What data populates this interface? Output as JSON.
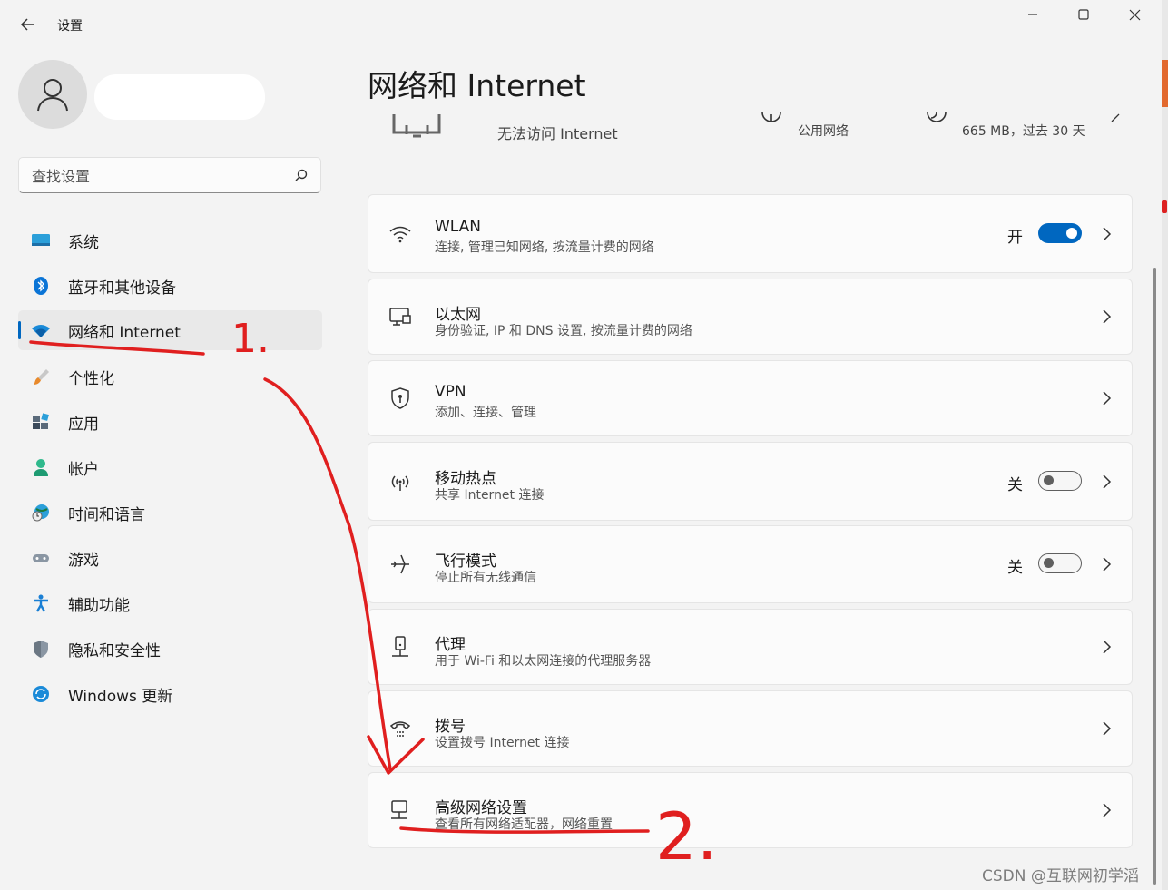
{
  "window": {
    "title": "设置",
    "controls": {
      "minimize": "minimize",
      "maximize": "maximize",
      "close": "close"
    }
  },
  "search": {
    "placeholder": "查找设置"
  },
  "sidebar": {
    "items": [
      {
        "label": "系统",
        "icon": "monitor-icon",
        "active": false
      },
      {
        "label": "蓝牙和其他设备",
        "icon": "bluetooth-icon",
        "active": false
      },
      {
        "label": "网络和 Internet",
        "icon": "wifi-diamond-icon",
        "active": true
      },
      {
        "label": "个性化",
        "icon": "brush-icon",
        "active": false
      },
      {
        "label": "应用",
        "icon": "apps-icon",
        "active": false
      },
      {
        "label": "帐户",
        "icon": "account-icon",
        "active": false
      },
      {
        "label": "时间和语言",
        "icon": "globe-clock-icon",
        "active": false
      },
      {
        "label": "游戏",
        "icon": "gamepad-icon",
        "active": false
      },
      {
        "label": "辅助功能",
        "icon": "accessibility-icon",
        "active": false
      },
      {
        "label": "隐私和安全性",
        "icon": "shield-icon",
        "active": false
      },
      {
        "label": "Windows 更新",
        "icon": "update-icon",
        "active": false
      }
    ]
  },
  "main": {
    "title": "网络和 Internet",
    "status": {
      "connection": "无法访问 Internet",
      "network_type": "公用网络",
      "usage": "665 MB，过去 30 天"
    },
    "cards": [
      {
        "title": "WLAN",
        "subtitle": "连接, 管理已知网络, 按流量计费的网络",
        "icon": "wifi-icon",
        "toggle_label": "开",
        "toggle": "on"
      },
      {
        "title": "以太网",
        "subtitle": "身份验证, IP 和 DNS 设置, 按流量计费的网络",
        "icon": "ethernet-icon"
      },
      {
        "title": "VPN",
        "subtitle": "添加、连接、管理",
        "icon": "vpn-shield-icon"
      },
      {
        "title": "移动热点",
        "subtitle": "共享 Internet 连接",
        "icon": "hotspot-icon",
        "toggle_label": "关",
        "toggle": "off"
      },
      {
        "title": "飞行模式",
        "subtitle": "停止所有无线通信",
        "icon": "airplane-icon",
        "toggle_label": "关",
        "toggle": "off"
      },
      {
        "title": "代理",
        "subtitle": "用于 Wi-Fi 和以太网连接的代理服务器",
        "icon": "proxy-icon"
      },
      {
        "title": "拨号",
        "subtitle": "设置拨号 Internet 连接",
        "icon": "dialup-icon"
      },
      {
        "title": "高级网络设置",
        "subtitle": "查看所有网络适配器，网络重置",
        "icon": "advanced-network-icon"
      }
    ]
  },
  "annotations": {
    "step1": "1.",
    "step2": "2."
  },
  "watermark": "CSDN @互联网初学滔",
  "colors": {
    "accent": "#0067c0",
    "annotation": "#e01f1f",
    "background": "#f3f3f3",
    "card": "#fbfbfb"
  }
}
